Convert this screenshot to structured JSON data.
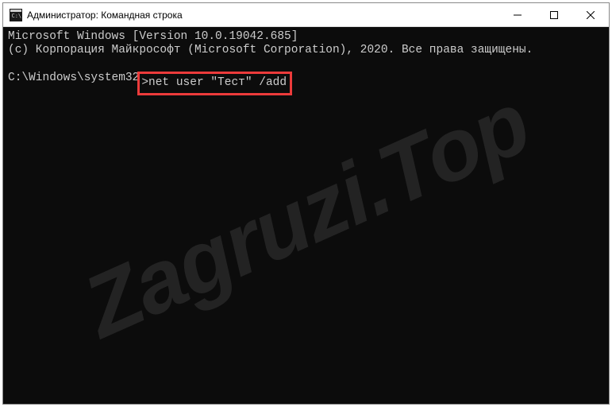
{
  "window": {
    "title": "Администратор: Командная строка"
  },
  "terminal": {
    "line1": "Microsoft Windows [Version 10.0.19042.685]",
    "line2": "(c) Корпорация Майкрософт (Microsoft Corporation), 2020. Все права защищены.",
    "prompt": "C:\\Windows\\system32",
    "command": ">net user \"Тест\" /add"
  },
  "watermark": "Zagruzi.Top"
}
